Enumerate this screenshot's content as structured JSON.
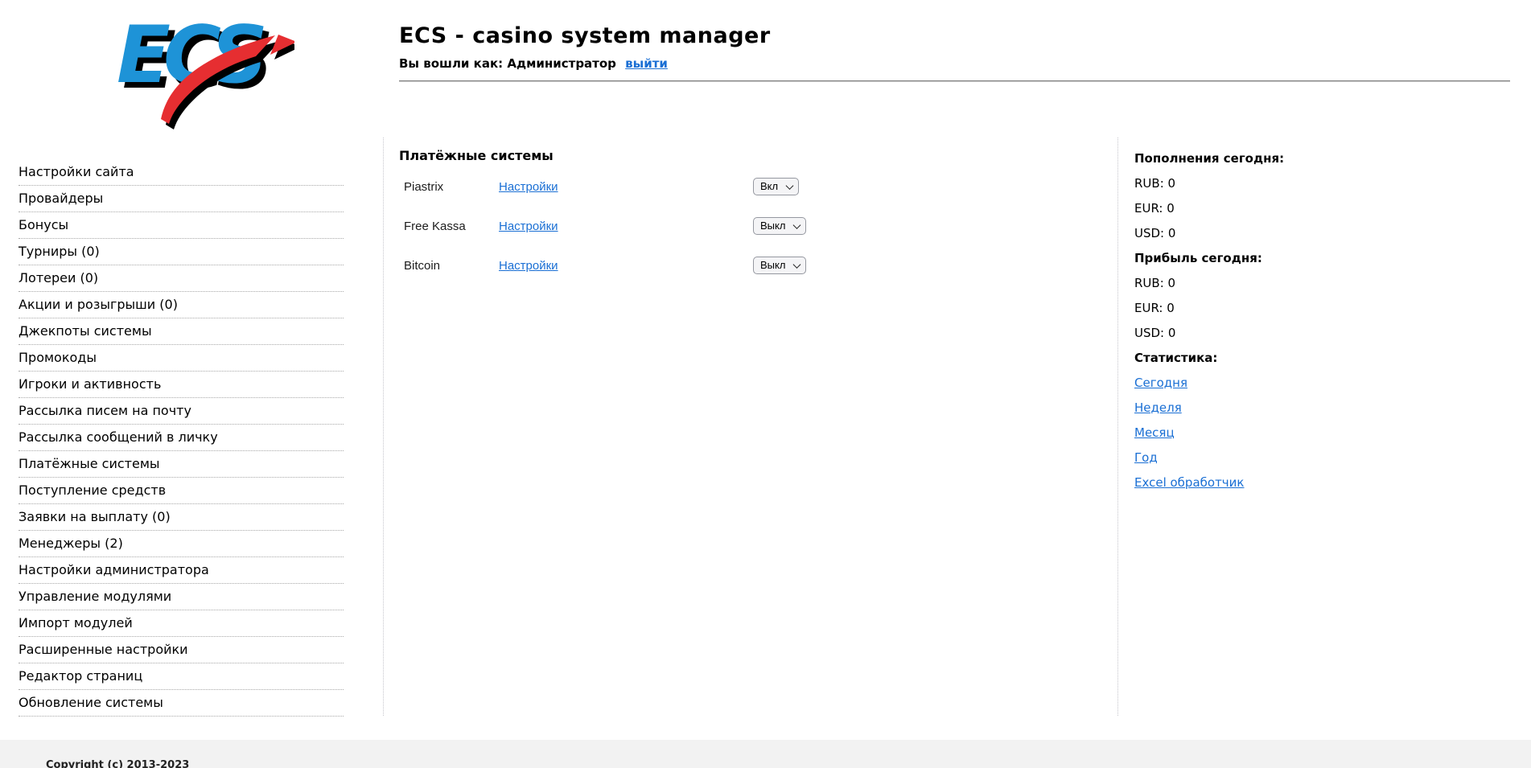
{
  "logo": {
    "text": "ECS"
  },
  "header": {
    "title": "ECS - casino system manager",
    "login_label": "Вы вошли как: Администратор",
    "logout_link": "выйти"
  },
  "sidebar": {
    "items": [
      "Настройки сайта",
      "Провайдеры",
      "Бонусы",
      "Турниры (0)",
      "Лотереи (0)",
      "Акции и розыгрыши (0)",
      "Джекпоты системы",
      "Промокоды",
      "Игроки и активность",
      "Рассылка писем на почту",
      "Рассылка сообщений в личку",
      "Платёжные системы",
      "Поступление средств",
      "Заявки на выплату (0)",
      "Менеджеры (2)",
      "Настройки администратора",
      "Управление модулями",
      "Импорт модулей",
      "Расширенные настройки",
      "Редактор страниц",
      "Обновление системы"
    ]
  },
  "main": {
    "title": "Платёжные системы",
    "settings_link_label": "Настройки",
    "rows": [
      {
        "name": "Piastrix",
        "state": "Вкл"
      },
      {
        "name": "Free Kassa",
        "state": "Выкл"
      },
      {
        "name": "Bitcoin",
        "state": "Выкл"
      }
    ]
  },
  "right_panel": {
    "deposits_title": "Пополнения сегодня:",
    "deposits": [
      "RUB: 0",
      "EUR: 0",
      "USD: 0"
    ],
    "profit_title": "Прибыль сегодня:",
    "profit": [
      "RUB: 0",
      "EUR: 0",
      "USD: 0"
    ],
    "stats_title": "Статистика:",
    "stats_links": [
      "Сегодня",
      "Неделя",
      "Месяц",
      "Год",
      "Excel обработчик"
    ]
  },
  "footer": {
    "copyright": "Copyright (c) 2013-2023"
  },
  "colors": {
    "logo_blue": "#1e93d7",
    "logo_red": "#e62e31",
    "link_blue": "#1a6fd4",
    "footer_bg": "#f2f2f2"
  }
}
